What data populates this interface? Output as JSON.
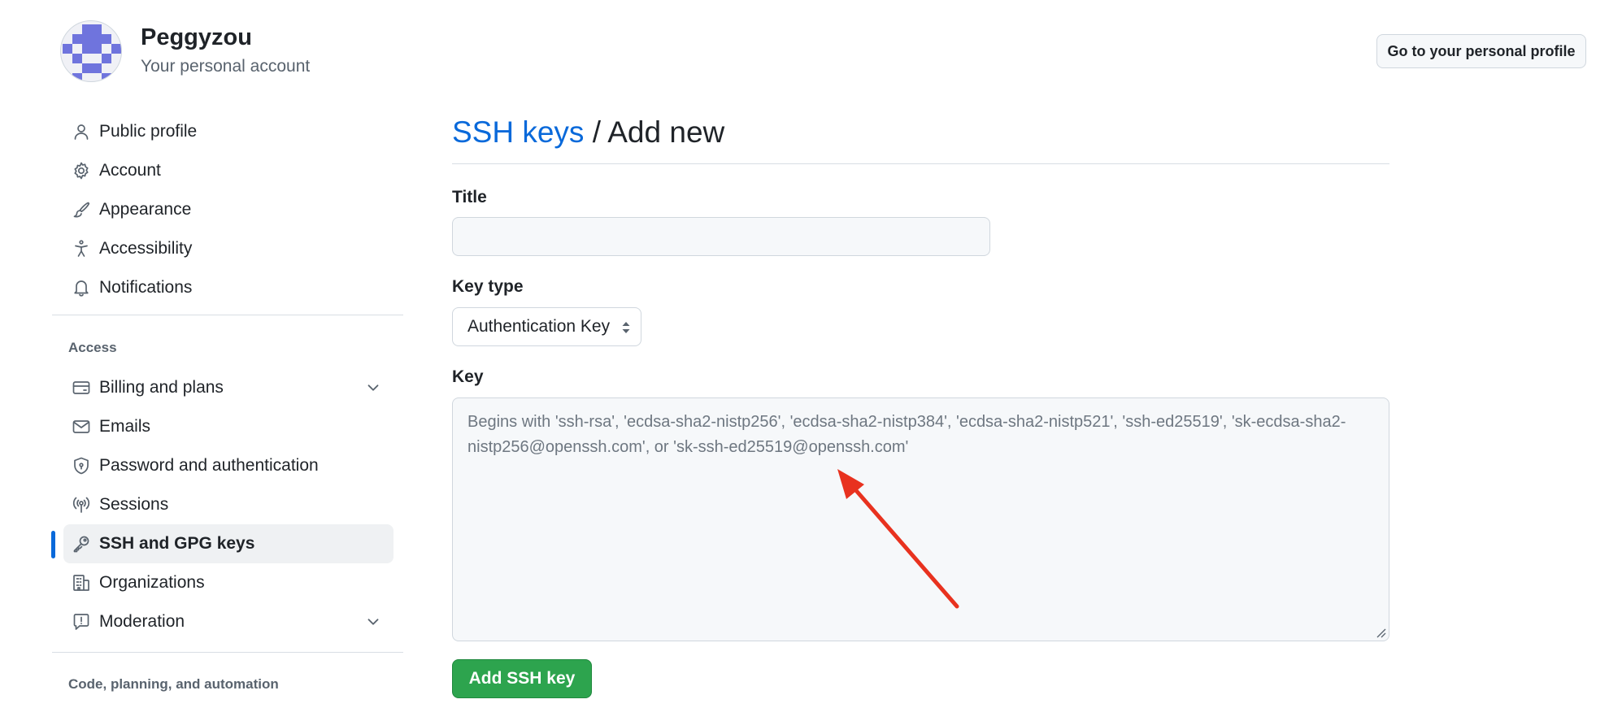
{
  "account": {
    "name": "Peggyzou",
    "subtitle": "Your personal account",
    "profile_button": "Go to your personal profile"
  },
  "sidebar": {
    "items": [
      {
        "label": "Public profile",
        "icon": "person-icon"
      },
      {
        "label": "Account",
        "icon": "gear-icon"
      },
      {
        "label": "Appearance",
        "icon": "paintbrush-icon"
      },
      {
        "label": "Accessibility",
        "icon": "accessibility-icon"
      },
      {
        "label": "Notifications",
        "icon": "bell-icon"
      }
    ],
    "access_heading": "Access",
    "access_items": [
      {
        "label": "Billing and plans",
        "icon": "credit-card-icon",
        "expandable": true
      },
      {
        "label": "Emails",
        "icon": "mail-icon"
      },
      {
        "label": "Password and authentication",
        "icon": "shield-lock-icon"
      },
      {
        "label": "Sessions",
        "icon": "broadcast-icon"
      },
      {
        "label": "SSH and GPG keys",
        "icon": "key-icon",
        "active": true
      },
      {
        "label": "Organizations",
        "icon": "organization-icon"
      },
      {
        "label": "Moderation",
        "icon": "report-icon",
        "expandable": true
      }
    ],
    "code_heading": "Code, planning, and automation"
  },
  "main": {
    "breadcrumb_link": "SSH keys",
    "breadcrumb_sep": " / ",
    "breadcrumb_current": "Add new",
    "title_label": "Title",
    "title_value": "",
    "key_type_label": "Key type",
    "key_type_selected": "Authentication Key",
    "key_label": "Key",
    "key_placeholder": "Begins with 'ssh-rsa', 'ecdsa-sha2-nistp256', 'ecdsa-sha2-nistp384', 'ecdsa-sha2-nistp521', 'ssh-ed25519', 'sk-ecdsa-sha2-nistp256@openssh.com', or 'sk-ssh-ed25519@openssh.com'",
    "submit_label": "Add SSH key"
  },
  "colors": {
    "accent": "#0969da",
    "primary_button": "#2da44e",
    "annotation_arrow": "#e8321f",
    "avatar": "#6f74dd"
  }
}
